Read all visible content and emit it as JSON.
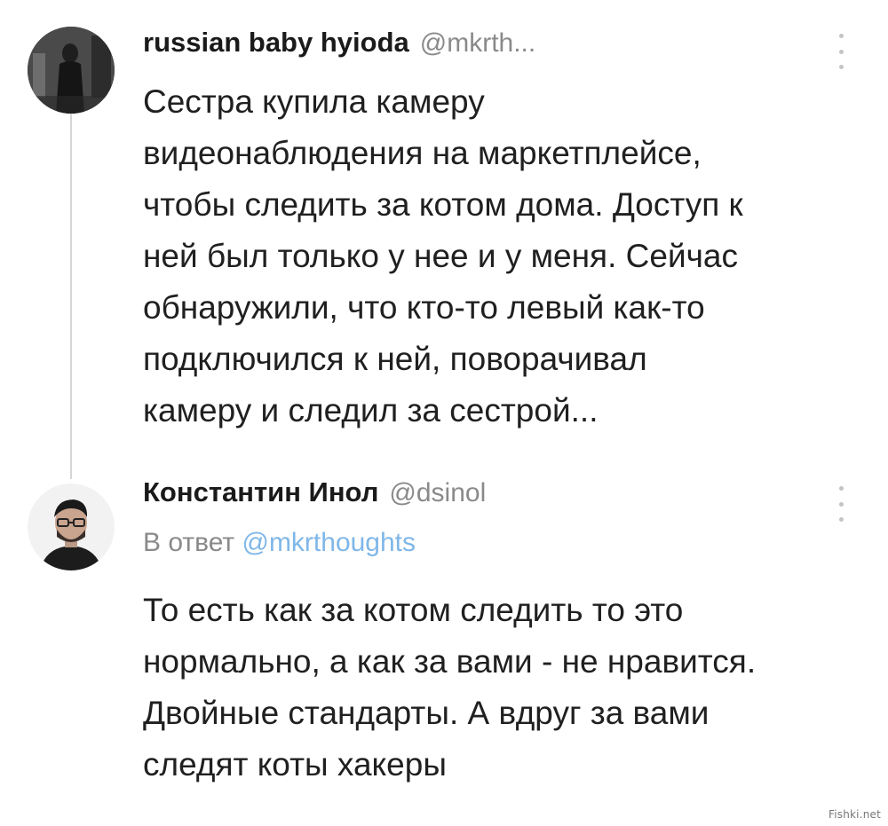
{
  "tweets": [
    {
      "author_name": "russian baby hyioda",
      "handle": "@mkrth...",
      "avatar_icon": "avatar-photo-person-dark",
      "more_icon": "more-vertical-icon",
      "body": "Сестра купила камеру\nвидеонаблюдения на маркетплейсе,\nчтобы следить за котом дома. Доступ к\nней был только у нее и у меня. Сейчас\nобнаружили, что кто-то левый как-то\nподключился к ней, поворачивал\nкамеру и следил за сестрой..."
    },
    {
      "author_name": "Константин Инол",
      "handle": "@dsinol",
      "reply_prefix": "В ответ",
      "reply_handle": "@mkrthoughts",
      "avatar_icon": "avatar-photo-man-glasses",
      "more_icon": "more-vertical-icon",
      "body": "То есть как за котом следить то это\nнормально, а как за вами - не нравится.\nДвойные стандарты. А вдруг за вами\nследят коты хакеры"
    }
  ],
  "watermark": "Fishki.net",
  "colors": {
    "text": "#202020",
    "muted": "#8a8a8a",
    "link": "#7fb7e8",
    "thread_line": "#d6d6d6"
  }
}
